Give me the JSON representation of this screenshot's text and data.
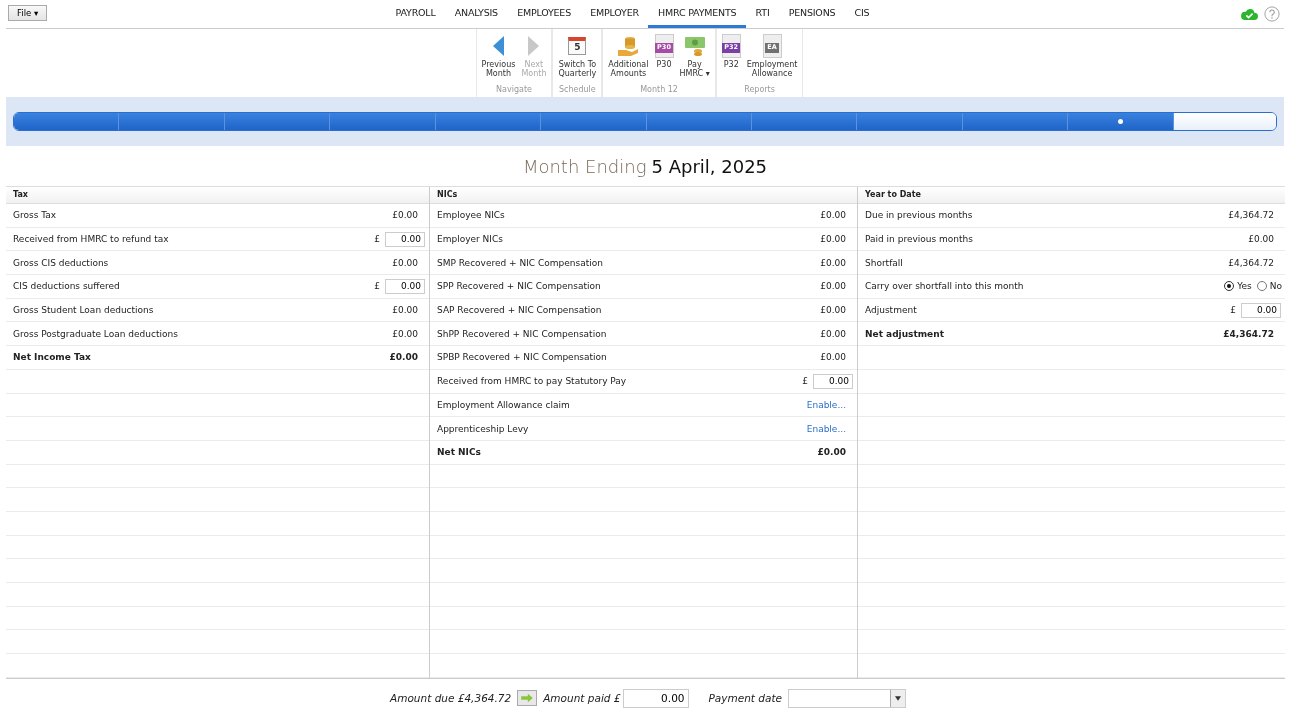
{
  "file_menu": {
    "label": "File ▾"
  },
  "nav_tabs": [
    {
      "label": "PAYROLL",
      "selected": false
    },
    {
      "label": "ANALYSIS",
      "selected": false
    },
    {
      "label": "EMPLOYEES",
      "selected": false
    },
    {
      "label": "EMPLOYER",
      "selected": false
    },
    {
      "label": "HMRC PAYMENTS",
      "selected": true
    },
    {
      "label": "RTI",
      "selected": false
    },
    {
      "label": "PENSIONS",
      "selected": false
    },
    {
      "label": "CIS",
      "selected": false
    }
  ],
  "ribbon": [
    {
      "group": "Navigate",
      "buttons": [
        {
          "kind": "prev",
          "label": [
            "Previous",
            "Month"
          ],
          "disabled": false
        },
        {
          "kind": "next",
          "label": [
            "Next",
            "Month"
          ],
          "disabled": true
        }
      ]
    },
    {
      "group": "Schedule",
      "buttons": [
        {
          "kind": "calendar",
          "badge": "5",
          "label": [
            "Switch To",
            "Quarterly"
          ],
          "disabled": false
        }
      ]
    },
    {
      "group": "Month 12",
      "buttons": [
        {
          "kind": "coins",
          "label": [
            "Additional",
            "Amounts"
          ],
          "disabled": false
        },
        {
          "kind": "doc",
          "badge": "P30",
          "color": "#a64ca6",
          "label": [
            "P30"
          ],
          "disabled": false
        },
        {
          "kind": "money",
          "label": [
            "Pay",
            "HMRC ▾"
          ],
          "disabled": false
        }
      ]
    },
    {
      "group": "Reports",
      "buttons": [
        {
          "kind": "doc",
          "badge": "P32",
          "color": "#7b3fa6",
          "label": [
            "P32"
          ],
          "disabled": false
        },
        {
          "kind": "doc",
          "badge": "EA",
          "color": "#707070",
          "label": [
            "Employment",
            "Allowance"
          ],
          "disabled": false
        }
      ]
    }
  ],
  "periods": [
    {
      "filled": true,
      "current": false
    },
    {
      "filled": true,
      "current": false
    },
    {
      "filled": true,
      "current": false
    },
    {
      "filled": true,
      "current": false
    },
    {
      "filled": true,
      "current": false
    },
    {
      "filled": true,
      "current": false
    },
    {
      "filled": true,
      "current": false
    },
    {
      "filled": true,
      "current": false
    },
    {
      "filled": true,
      "current": false
    },
    {
      "filled": true,
      "current": false
    },
    {
      "filled": true,
      "current": true
    },
    {
      "filled": false,
      "current": false
    }
  ],
  "heading": {
    "prefix": "Month Ending",
    "date": "5 April, 2025"
  },
  "columns": [
    {
      "title": "Tax",
      "rows": [
        {
          "kind": "amount",
          "label": "Gross Tax",
          "value": "£0.00"
        },
        {
          "kind": "input",
          "label": "Received from HMRC to refund tax",
          "currency": "£",
          "value": "0.00"
        },
        {
          "kind": "amount",
          "label": "Gross CIS deductions",
          "value": "£0.00"
        },
        {
          "kind": "input",
          "label": "CIS deductions suffered",
          "currency": "£",
          "value": "0.00"
        },
        {
          "kind": "amount",
          "label": "Gross Student Loan deductions",
          "value": "£0.00"
        },
        {
          "kind": "amount",
          "label": "Gross Postgraduate Loan deductions",
          "value": "£0.00"
        },
        {
          "kind": "total",
          "label": "Net Income Tax",
          "value": "£0.00"
        }
      ]
    },
    {
      "title": "NICs",
      "rows": [
        {
          "kind": "amount",
          "label": "Employee NICs",
          "value": "£0.00"
        },
        {
          "kind": "amount",
          "label": "Employer NICs",
          "value": "£0.00"
        },
        {
          "kind": "amount",
          "label": "SMP Recovered + NIC Compensation",
          "value": "£0.00"
        },
        {
          "kind": "amount",
          "label": "SPP Recovered + NIC Compensation",
          "value": "£0.00"
        },
        {
          "kind": "amount",
          "label": "SAP Recovered + NIC Compensation",
          "value": "£0.00"
        },
        {
          "kind": "amount",
          "label": "ShPP Recovered + NIC Compensation",
          "value": "£0.00"
        },
        {
          "kind": "amount",
          "label": "SPBP Recovered + NIC Compensation",
          "value": "£0.00"
        },
        {
          "kind": "input",
          "label": "Received from HMRC to pay Statutory Pay",
          "currency": "£",
          "value": "0.00"
        },
        {
          "kind": "link",
          "label": "Employment Allowance claim",
          "value": "Enable..."
        },
        {
          "kind": "link",
          "label": "Apprenticeship Levy",
          "value": "Enable..."
        },
        {
          "kind": "total",
          "label": "Net NICs",
          "value": "£0.00"
        }
      ]
    },
    {
      "title": "Year to Date",
      "rows": [
        {
          "kind": "amount",
          "label": "Due in previous months",
          "value": "£4,364.72"
        },
        {
          "kind": "amount",
          "label": "Paid in previous months",
          "value": "£0.00"
        },
        {
          "kind": "amount",
          "label": "Shortfall",
          "value": "£4,364.72"
        },
        {
          "kind": "radio",
          "label": "Carry over shortfall into this month",
          "options": [
            {
              "label": "Yes",
              "selected": true
            },
            {
              "label": "No",
              "selected": false
            }
          ]
        },
        {
          "kind": "input",
          "label": "Adjustment",
          "currency": "£",
          "value": "0.00"
        },
        {
          "kind": "total",
          "label": "Net adjustment",
          "value": "£4,364.72"
        }
      ]
    }
  ],
  "footer": {
    "amount_due": "Amount due £4,364.72",
    "amount_paid_label": "Amount paid £",
    "amount_paid": "0.00",
    "payment_date_label": "Payment date"
  }
}
